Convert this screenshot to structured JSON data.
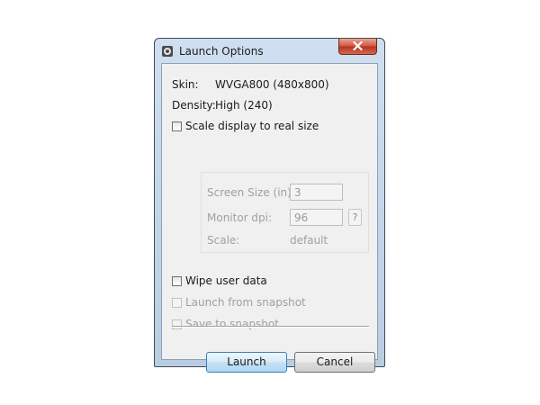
{
  "window": {
    "title": "Launch Options"
  },
  "info": {
    "skin_label": "Skin:",
    "skin_value": "WVGA800 (480x800)",
    "density_label": "Density:",
    "density_value": "High (240)"
  },
  "options": {
    "scale_display": {
      "label": "Scale display to real size",
      "checked": false,
      "enabled": true
    },
    "wipe_user_data": {
      "label": "Wipe user data",
      "checked": false,
      "enabled": true
    },
    "launch_from_snapshot": {
      "label": "Launch from snapshot",
      "checked": false,
      "enabled": false
    },
    "save_to_snapshot": {
      "label": "Save to snapshot",
      "checked": false,
      "enabled": false
    }
  },
  "scale_group": {
    "screen_size_label": "Screen Size (in):",
    "screen_size_value": "3",
    "monitor_dpi_label": "Monitor dpi:",
    "monitor_dpi_value": "96",
    "help_label": "?",
    "scale_label": "Scale:",
    "scale_value": "default"
  },
  "buttons": {
    "launch": "Launch",
    "cancel": "Cancel"
  },
  "icons": {
    "app": "emulator-icon",
    "close": "close-icon"
  },
  "colors": {
    "close_button": "#c94a33",
    "launch_border": "#3c7fb1",
    "disabled_text": "#a0a0a0"
  }
}
